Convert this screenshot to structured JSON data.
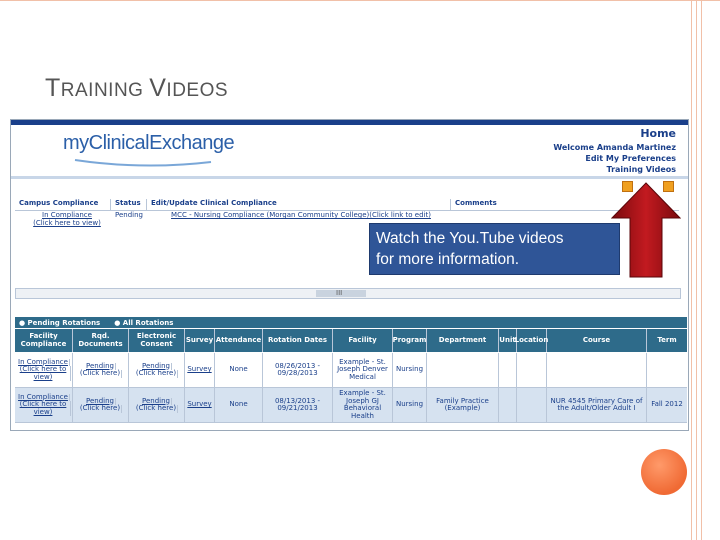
{
  "slide": {
    "title_first_letter": "T",
    "title_rest_1": "RAINING ",
    "title_second_letter": "V",
    "title_rest_2": "IDEOS"
  },
  "app": {
    "logo": "myClinicalExchange",
    "header": {
      "home": "Home",
      "welcome": "Welcome Amanda Martinez",
      "preferences": "Edit My Preferences",
      "training": "Training Videos"
    }
  },
  "compliance": {
    "headers": [
      "Campus Compliance",
      "Status",
      "Edit/Update Clinical Compliance",
      "Comments"
    ],
    "row": {
      "campus": "In Compliance",
      "campus_sub": "(Click here to view)",
      "status": "Pending",
      "edit": "MCC - Nursing Compliance (Morgan Community College)(Click link to edit)",
      "comments": ""
    }
  },
  "tooltip": {
    "line1": "Watch the You.Tube videos",
    "line2": "for more information."
  },
  "scrollbar": {
    "grip": "III"
  },
  "rotations": {
    "tab_pending": "Pending Rotations",
    "tab_all": "All Rotations",
    "headers": [
      "Facility Compliance",
      "Rqd. Documents",
      "Electronic Consent",
      "Survey",
      "Attendance",
      "Rotation Dates",
      "Facility",
      "Program",
      "Department",
      "Unit",
      "Location",
      "Course",
      "Term"
    ],
    "rows": [
      {
        "facility_compliance": "In Compliance",
        "facility_compliance_sub": "(Click here to view)",
        "documents": "Pending",
        "documents_sub": "(Click here)",
        "consent": "Pending",
        "consent_sub": "(Click here)",
        "survey": "Survey",
        "attendance": "None",
        "dates": "08/26/2013 - 09/28/2013",
        "facility": "Example - St. Joseph Denver Medical",
        "program": "Nursing",
        "department": "",
        "unit": "",
        "location": "",
        "course": "",
        "term": ""
      },
      {
        "facility_compliance": "In Compliance",
        "facility_compliance_sub": "(Click here to view)",
        "documents": "Pending",
        "documents_sub": "(Click here)",
        "consent": "Pending",
        "consent_sub": "(Click here)",
        "survey": "Survey",
        "attendance": "None",
        "dates": "08/13/2013 - 09/21/2013",
        "facility": "Example - St. Joseph GJ Behavioral Health",
        "program": "Nursing",
        "department": "Family Practice (Example)",
        "unit": "",
        "location": "",
        "course": "NUR 4545 Primary Care of the Adult/Older Adult I",
        "term": "Fall 2012"
      }
    ]
  },
  "colors": {
    "accent_dark": "#1a3f8a",
    "table_header": "#2e6b8a",
    "tooltip_bg": "#2f5597",
    "arrow": "#b3151b",
    "orange": "#f06a34"
  }
}
